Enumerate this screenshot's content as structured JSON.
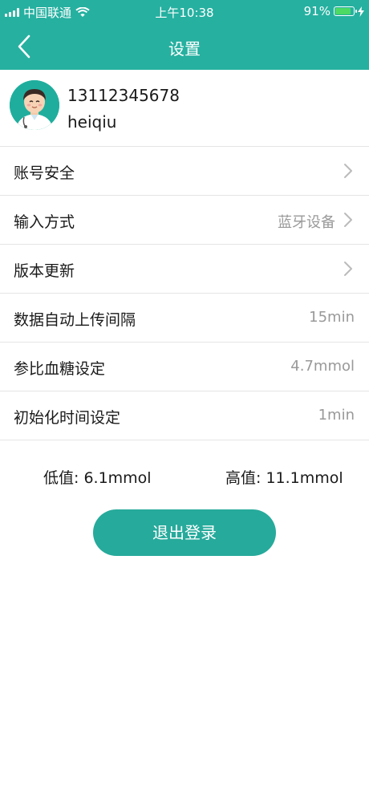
{
  "status_bar": {
    "carrier": "中国联通",
    "time": "上午10:38",
    "battery_percent_text": "91%",
    "battery_level": 0.91
  },
  "nav": {
    "title": "设置",
    "back_icon": "chevron-left-icon"
  },
  "profile": {
    "phone": "13112345678",
    "username": "heiqiu"
  },
  "settings": [
    {
      "label": "账号安全",
      "value": "",
      "arrow": true
    },
    {
      "label": "输入方式",
      "value": "蓝牙设备",
      "arrow": true
    },
    {
      "label": "版本更新",
      "value": "",
      "arrow": true
    },
    {
      "label": "数据自动上传间隔",
      "value": "15min",
      "arrow": false
    },
    {
      "label": "参比血糖设定",
      "value": "4.7mmol",
      "arrow": false
    },
    {
      "label": "初始化时间设定",
      "value": "1min",
      "arrow": false
    }
  ],
  "limits": {
    "low": "低值: 6.1mmol",
    "high": "高值: 11.1mmol"
  },
  "logout_label": "退出登录",
  "colors": {
    "primary": "#26b0a0",
    "button": "#26aa9b",
    "battery_fill": "#4cd964"
  }
}
